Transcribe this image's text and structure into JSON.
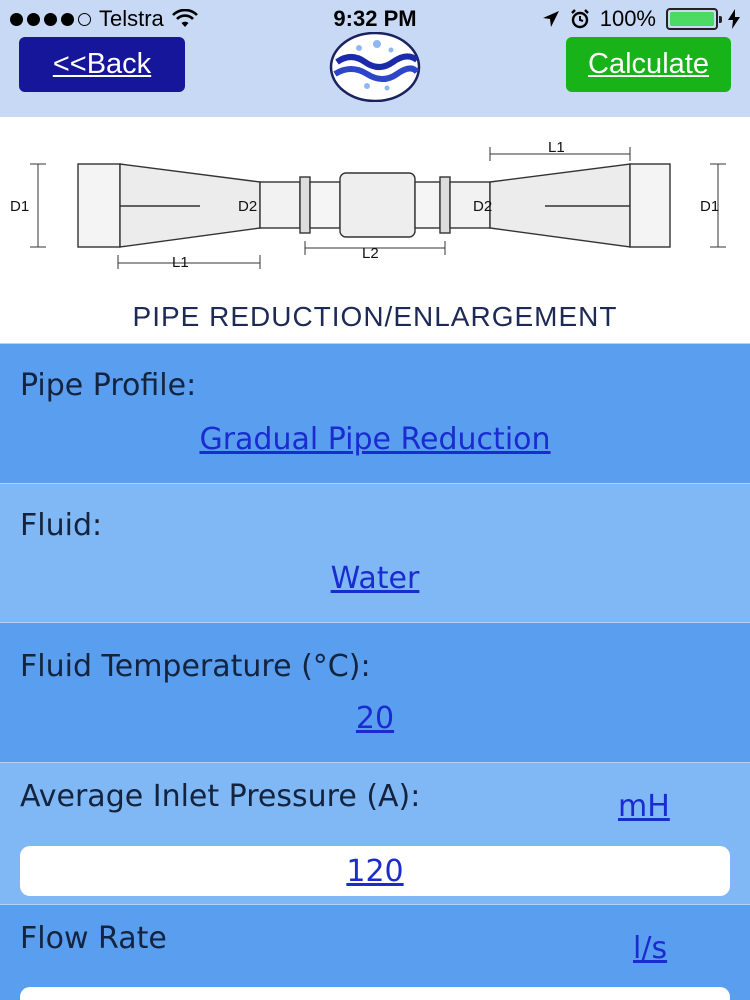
{
  "status_bar": {
    "carrier": "Telstra",
    "time": "9:32 PM",
    "battery": "100%",
    "battery_level": 1.0,
    "signal_bars": 4
  },
  "nav": {
    "back_label": "<<Back",
    "calculate_label": "Calculate"
  },
  "diagram": {
    "title": "PIPE REDUCTION/ENLARGEMENT",
    "labels": {
      "d1": "D1",
      "d2": "D2",
      "l1": "L1",
      "l2": "L2"
    }
  },
  "form": {
    "pipe_profile": {
      "label": "Pipe Profile:",
      "value": "Gradual Pipe Reduction"
    },
    "fluid": {
      "label": "Fluid:",
      "value": "Water"
    },
    "fluid_temperature": {
      "label": "Fluid Temperature (°C):",
      "value": "20"
    },
    "inlet_pressure": {
      "label": "Average Inlet Pressure (A):",
      "unit": "mH",
      "value": "120"
    },
    "flow_rate": {
      "label": "Flow Rate",
      "unit": "l/s"
    }
  },
  "colors": {
    "back_button": "#16169a",
    "calculate_button": "#18b318",
    "section_dark": "#5a9eef",
    "section_light": "#80b8f5",
    "link": "#1a2bd0"
  }
}
